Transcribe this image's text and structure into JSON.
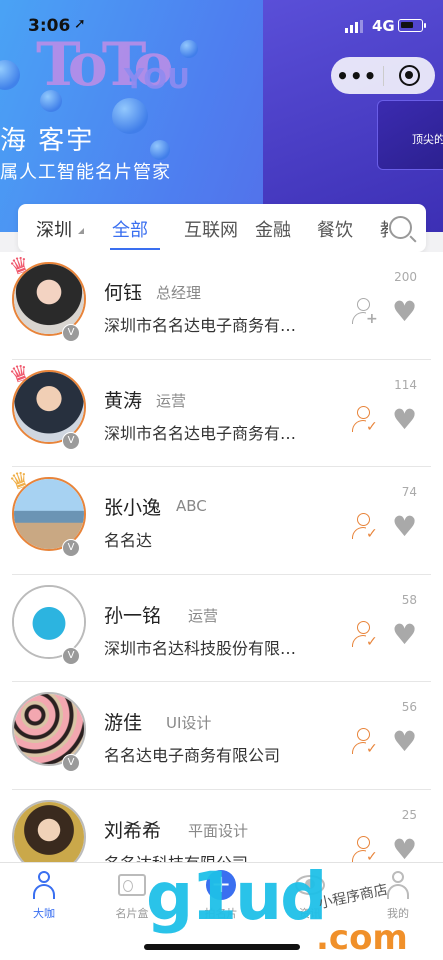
{
  "status_bar": {
    "time": "3:06",
    "network": "4G"
  },
  "banner": {
    "title": "海 客宇",
    "subtitle": "属人工智能名片管家",
    "side_card_text": "顶尖的"
  },
  "capsule": {
    "more": "•••"
  },
  "category_bar": {
    "city": "深圳",
    "tabs": [
      "全部",
      "互联网",
      "金融",
      "餐饮",
      "教"
    ],
    "active_tab": "全部"
  },
  "contacts": [
    {
      "name": "何钰",
      "title": "总经理",
      "company": "深圳市名名达电子商务有…",
      "count": "200",
      "status": "add",
      "crown": "1"
    },
    {
      "name": "黄涛",
      "title": "运营",
      "company": "深圳市名名达电子商务有…",
      "count": "114",
      "status": "added",
      "crown": "2"
    },
    {
      "name": "张小逸",
      "title": "ABC",
      "company": "名名达",
      "count": "74",
      "status": "added",
      "crown": "3"
    },
    {
      "name": "孙一铭",
      "title": "运营",
      "company": "深圳市名达科技股份有限…",
      "count": "58",
      "status": "added",
      "crown": ""
    },
    {
      "name": "游佳",
      "title": "UI设计",
      "company": "名名达电子商务有限公司",
      "count": "56",
      "status": "added",
      "crown": ""
    },
    {
      "name": "刘希希",
      "title": "平面设计",
      "company": "名名达科技有限公司",
      "count": "25",
      "status": "added",
      "crown": ""
    }
  ],
  "tabbar": {
    "items": [
      {
        "label": "大咖",
        "icon": "person-icon"
      },
      {
        "label": "名片盒",
        "icon": "card-icon"
      },
      {
        "label": "拍名片",
        "icon": "plus-icon"
      },
      {
        "label": "资讯",
        "icon": "eye-icon"
      },
      {
        "label": "我的",
        "icon": "me-icon"
      }
    ]
  },
  "watermark": {
    "main": "g1ud",
    "suffix": ".com",
    "hand": "小程序商店"
  },
  "colors": {
    "accent": "#3a6ff0",
    "orange": "#e8843a",
    "gray_icon": "#a9a9a9"
  }
}
